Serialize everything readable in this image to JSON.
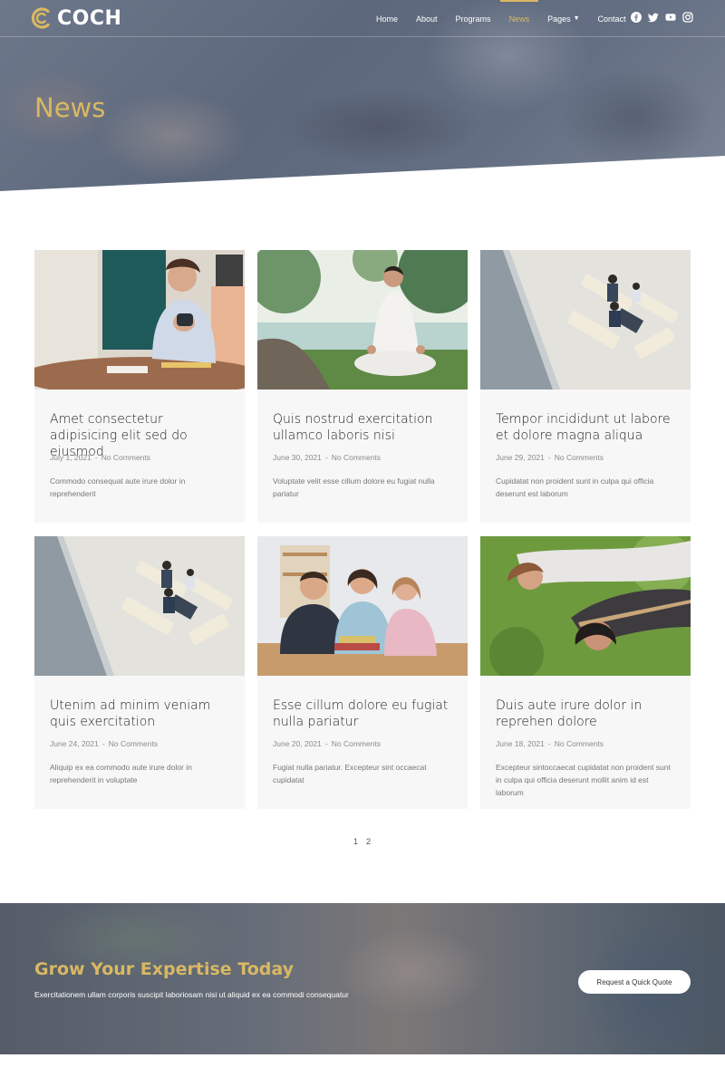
{
  "brand": {
    "name": "COCH",
    "accent": "#d9b863"
  },
  "nav": {
    "items": [
      {
        "label": "Home"
      },
      {
        "label": "About"
      },
      {
        "label": "Programs"
      },
      {
        "label": "News",
        "active": true
      },
      {
        "label": "Pages",
        "dropdown": true
      },
      {
        "label": "Contact"
      }
    ],
    "socials": [
      "facebook-icon",
      "twitter-icon",
      "youtube-icon",
      "instagram-icon"
    ]
  },
  "hero": {
    "title": "News"
  },
  "posts": [
    {
      "title": "Amet consectetur adipisicing elit sed do eiusmod",
      "date": "July 1, 2021",
      "comments": "No Comments",
      "excerpt": "Commodo consequat aute irure dolor in reprehenderit",
      "image": "woman-with-mug-photo"
    },
    {
      "title": "Quis nostrud exercitation ullamco laboris nisi",
      "date": "June 30, 2021",
      "comments": "No Comments",
      "excerpt": "Voluptate velit esse cillum dolore eu fugiat nulla pariatur",
      "image": "meditation-outdoors-photo"
    },
    {
      "title": "Tempor incididunt ut labore et dolore magna aliqua",
      "date": "June 29, 2021",
      "comments": "No Comments",
      "excerpt": "Cupidatat non proident sunt in culpa qui officia deserunt est laborum",
      "image": "lounge-meeting-photo"
    },
    {
      "title": "Utenim ad minim veniam quis exercitation",
      "date": "June 24, 2021",
      "comments": "No Comments",
      "excerpt": "Aliquip ex ea commodo aute irure dolor in reprehenderit in voluptate",
      "image": "lounge-meeting-photo"
    },
    {
      "title": "Esse cillum dolore eu fugiat nulla pariatur",
      "date": "June 20, 2021",
      "comments": "No Comments",
      "excerpt": "Fugiat nulla pariatur. Excepteur sint occaecat cupidatat",
      "image": "students-group-photo"
    },
    {
      "title": "Duis aute irure dolor in reprehen dolore",
      "date": "June 18, 2021",
      "comments": "No Comments",
      "excerpt": "Excepteur sintoccaecat cupidatat non proident sunt in culpa qui officia deserunt mollit anim id est laborum",
      "image": "lying-on-grass-photo"
    }
  ],
  "pagination": {
    "pages": [
      "1",
      "2"
    ]
  },
  "cta": {
    "title": "Grow Your Expertise Today",
    "text": "Exercitationem ullam corporis suscipit laboriosam nisi ut aliquid ex ea commodi consequatur",
    "button": "Request a Quick Quote"
  }
}
